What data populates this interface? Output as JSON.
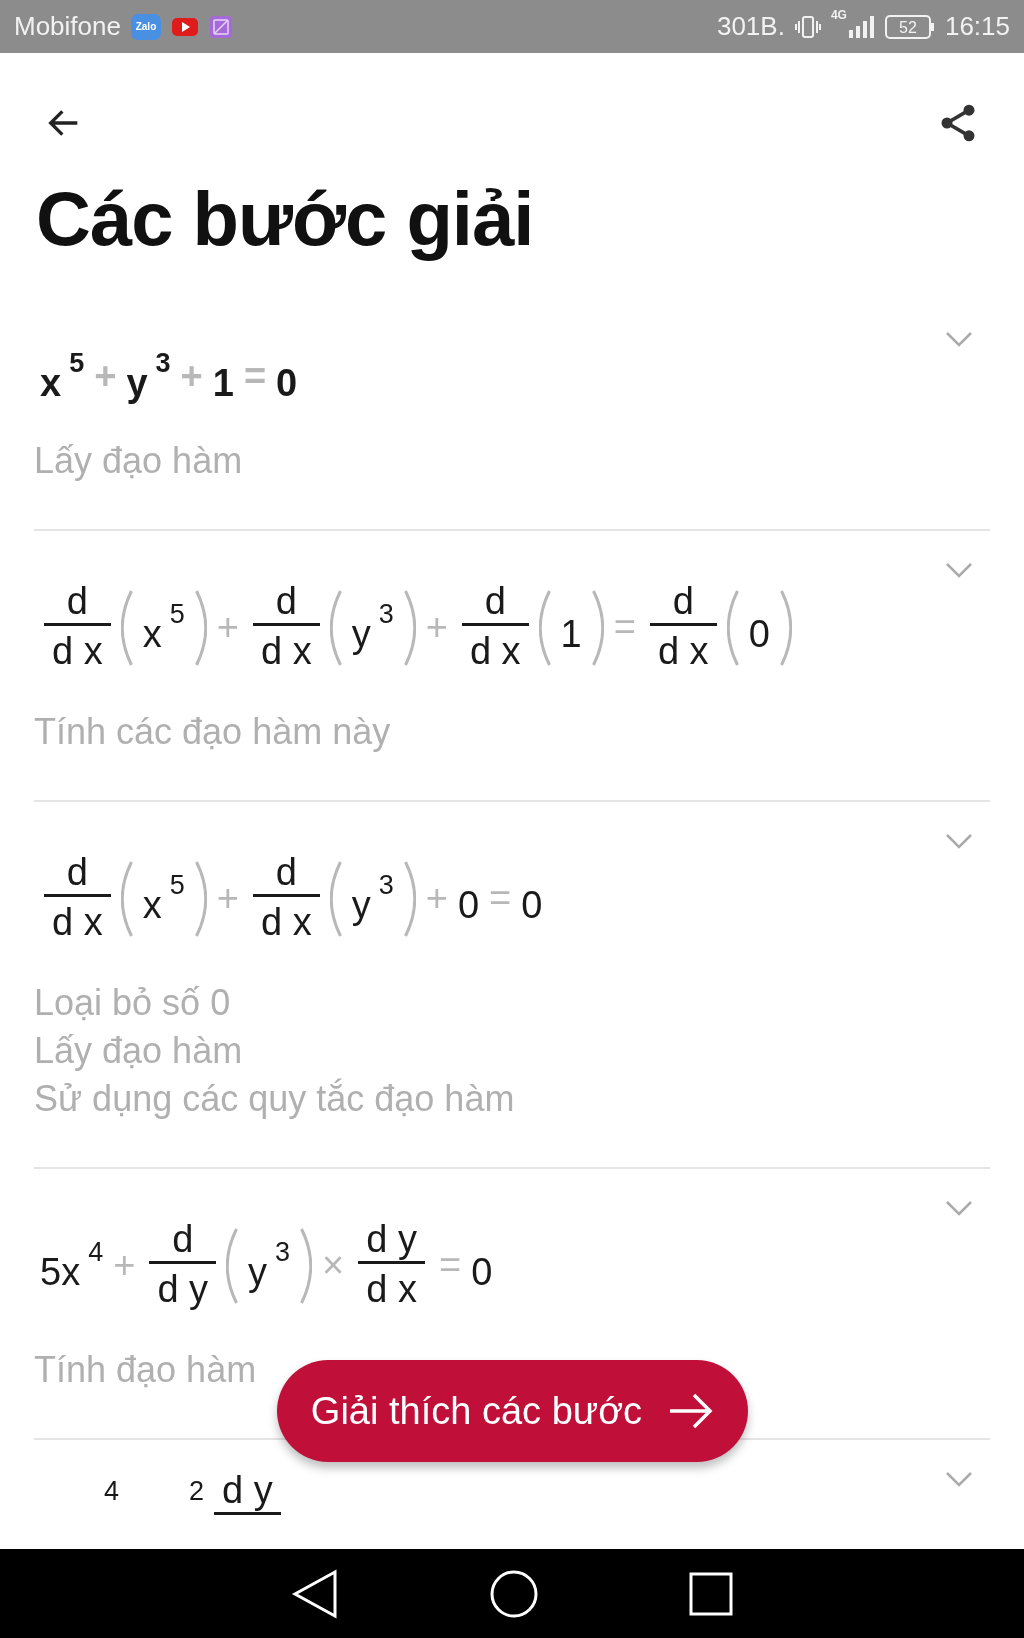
{
  "status_bar": {
    "carrier": "Mobifone",
    "notifications": [
      {
        "kind": "chat",
        "label": "Zalo"
      },
      {
        "kind": "video"
      },
      {
        "kind": "gallery"
      }
    ],
    "speed": "301B.",
    "network": "4G",
    "battery": "52",
    "time": "16:15"
  },
  "header": {
    "title": "Các bước giải"
  },
  "steps": [
    {
      "emphasized": true,
      "expression": [
        {
          "kind": "term",
          "text": "x",
          "sup": "5"
        },
        {
          "kind": "op",
          "text": "+"
        },
        {
          "kind": "term",
          "text": "y",
          "sup": "3"
        },
        {
          "kind": "op",
          "text": "+"
        },
        {
          "kind": "term",
          "text": "1"
        },
        {
          "kind": "op",
          "text": "="
        },
        {
          "kind": "term",
          "text": "0"
        }
      ],
      "notes": [
        "Lấy đạo hàm"
      ]
    },
    {
      "emphasized": false,
      "expression": [
        {
          "kind": "frac",
          "num": "d",
          "den": "d x"
        },
        {
          "kind": "paren",
          "items": [
            {
              "kind": "term",
              "text": "x",
              "sup": "5"
            }
          ]
        },
        {
          "kind": "op",
          "text": "+"
        },
        {
          "kind": "frac",
          "num": "d",
          "den": "d x"
        },
        {
          "kind": "paren",
          "items": [
            {
              "kind": "term",
              "text": "y",
              "sup": "3"
            }
          ]
        },
        {
          "kind": "op",
          "text": "+"
        },
        {
          "kind": "frac",
          "num": "d",
          "den": "d x"
        },
        {
          "kind": "paren",
          "items": [
            {
              "kind": "term",
              "text": "1"
            }
          ]
        },
        {
          "kind": "op",
          "text": "="
        },
        {
          "kind": "frac",
          "num": "d",
          "den": "d x"
        },
        {
          "kind": "paren",
          "items": [
            {
              "kind": "term",
              "text": "0"
            }
          ]
        }
      ],
      "notes": [
        "Tính các đạo hàm này"
      ]
    },
    {
      "emphasized": false,
      "expression": [
        {
          "kind": "frac",
          "num": "d",
          "den": "d x"
        },
        {
          "kind": "paren",
          "items": [
            {
              "kind": "term",
              "text": "x",
              "sup": "5"
            }
          ]
        },
        {
          "kind": "op",
          "text": "+"
        },
        {
          "kind": "frac",
          "num": "d",
          "den": "d x"
        },
        {
          "kind": "paren",
          "items": [
            {
              "kind": "term",
              "text": "y",
              "sup": "3"
            }
          ]
        },
        {
          "kind": "op",
          "text": "+"
        },
        {
          "kind": "term",
          "text": "0"
        },
        {
          "kind": "op",
          "text": "="
        },
        {
          "kind": "term",
          "text": "0"
        }
      ],
      "notes": [
        "Loại bỏ số 0",
        "Lấy đạo hàm",
        "Sử dụng các quy tắc đạo hàm"
      ]
    },
    {
      "emphasized": false,
      "expression": [
        {
          "kind": "term",
          "text": "5x",
          "sup": "4"
        },
        {
          "kind": "op",
          "text": "+"
        },
        {
          "kind": "frac",
          "num": "d",
          "den": "d y"
        },
        {
          "kind": "paren",
          "items": [
            {
              "kind": "term",
              "text": "y",
              "sup": "3"
            }
          ]
        },
        {
          "kind": "op",
          "text": "×"
        },
        {
          "kind": "frac",
          "num": "d y",
          "den": "d x"
        },
        {
          "kind": "op",
          "text": "="
        },
        {
          "kind": "term",
          "text": "0"
        }
      ],
      "notes": [
        "Tính đạo hàm"
      ]
    },
    {
      "emphasized": false,
      "expression": [
        {
          "kind": "term",
          "sup": "4"
        },
        {
          "kind": "term",
          "sup": "2"
        },
        {
          "kind": "frac",
          "num": "d y"
        }
      ]
    }
  ],
  "action_button": {
    "label": "Giải thích các bước"
  }
}
